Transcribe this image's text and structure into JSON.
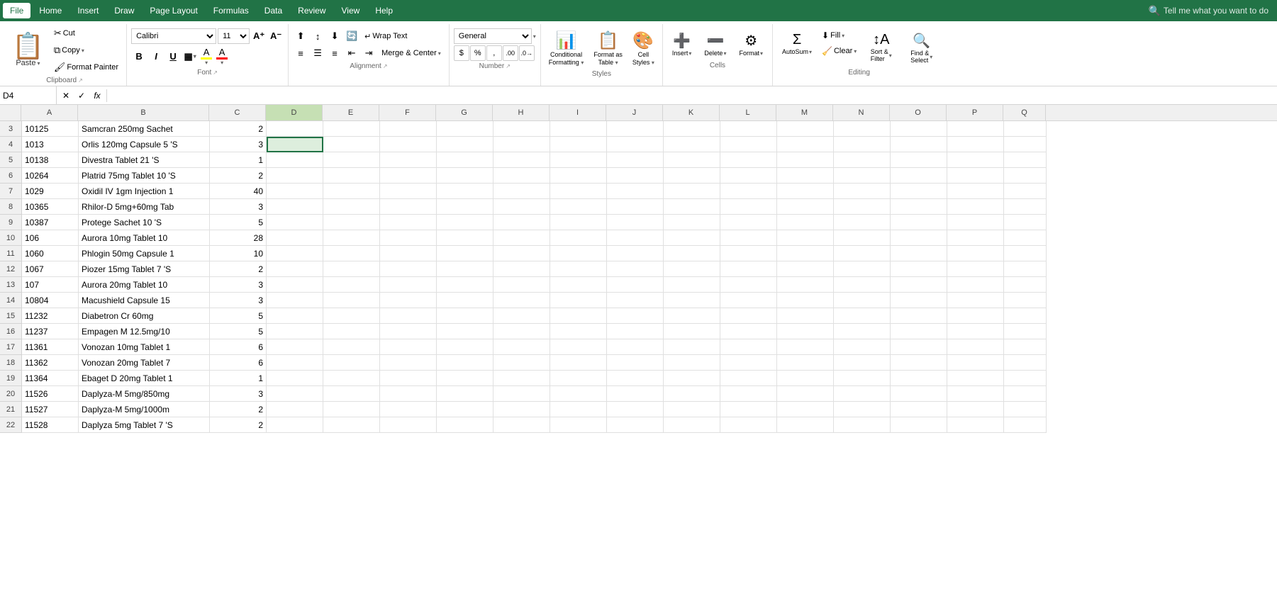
{
  "menu": {
    "items": [
      {
        "label": "File",
        "active": false
      },
      {
        "label": "Home",
        "active": true
      },
      {
        "label": "Insert",
        "active": false
      },
      {
        "label": "Draw",
        "active": false
      },
      {
        "label": "Page Layout",
        "active": false
      },
      {
        "label": "Formulas",
        "active": false
      },
      {
        "label": "Data",
        "active": false
      },
      {
        "label": "Review",
        "active": false
      },
      {
        "label": "View",
        "active": false
      },
      {
        "label": "Help",
        "active": false
      }
    ],
    "search_placeholder": "Tell me what you want to do"
  },
  "ribbon": {
    "clipboard": {
      "label": "Clipboard",
      "paste": "Paste",
      "cut": "Cut",
      "copy": "Copy",
      "format_painter": "Format Painter"
    },
    "font": {
      "label": "Font",
      "family": "Calibri",
      "size": "11",
      "bold": "B",
      "italic": "I",
      "underline": "U",
      "border": "⊞",
      "highlight": "A",
      "color": "A"
    },
    "alignment": {
      "label": "Alignment",
      "wrap_text": "Wrap Text",
      "merge_center": "Merge & Center"
    },
    "number": {
      "label": "Number",
      "format": "General",
      "dollar": "$",
      "percent": "%",
      "comma": ",",
      "increase_decimal": ".0",
      "decrease_decimal": ".00"
    },
    "styles": {
      "label": "Styles",
      "conditional": "Conditional\nFormatting",
      "format_table": "Format as\nTable",
      "cell_styles": "Cell\nStyles"
    },
    "cells": {
      "label": "Cells",
      "insert": "Insert",
      "delete": "Delete",
      "format": "Format"
    },
    "editing": {
      "label": "Editing",
      "autosum": "AutoSum",
      "fill": "Fill",
      "clear": "Clear",
      "sort_filter": "Sort &\nFilter",
      "find_select": "Find &\nSelect"
    }
  },
  "formula_bar": {
    "name_box": "D4",
    "cancel": "✕",
    "confirm": "✓",
    "function": "fx",
    "formula": ""
  },
  "columns": [
    "A",
    "B",
    "C",
    "D",
    "E",
    "F",
    "G",
    "H",
    "I",
    "J",
    "K",
    "L",
    "M",
    "N",
    "O",
    "P",
    "Q"
  ],
  "rows": [
    {
      "num": 3,
      "cells": [
        "10125",
        "Samcran 250mg Sachet",
        "2",
        "",
        "",
        "",
        "",
        "",
        "",
        "",
        "",
        "",
        "",
        "",
        "",
        "",
        ""
      ]
    },
    {
      "num": 4,
      "cells": [
        "1013",
        "Orlis 120mg Capsule 5 'S",
        "3",
        "",
        "",
        "",
        "",
        "",
        "",
        "",
        "",
        "",
        "",
        "",
        "",
        "",
        ""
      ],
      "selected_col": 3
    },
    {
      "num": 5,
      "cells": [
        "10138",
        "Divestra Tablet 21 'S",
        "1",
        "",
        "",
        "",
        "",
        "",
        "",
        "",
        "",
        "",
        "",
        "",
        "",
        "",
        ""
      ]
    },
    {
      "num": 6,
      "cells": [
        "10264",
        "Platrid 75mg Tablet 10 'S",
        "2",
        "",
        "",
        "",
        "",
        "",
        "",
        "",
        "",
        "",
        "",
        "",
        "",
        "",
        ""
      ]
    },
    {
      "num": 7,
      "cells": [
        "1029",
        "Oxidil IV 1gm Injection 1",
        "40",
        "",
        "",
        "",
        "",
        "",
        "",
        "",
        "",
        "",
        "",
        "",
        "",
        "",
        ""
      ]
    },
    {
      "num": 8,
      "cells": [
        "10365",
        "Rhilor-D 5mg+60mg Tab",
        "3",
        "",
        "",
        "",
        "",
        "",
        "",
        "",
        "",
        "",
        "",
        "",
        "",
        "",
        ""
      ]
    },
    {
      "num": 9,
      "cells": [
        "10387",
        "Protege Sachet 10 'S",
        "5",
        "",
        "",
        "",
        "",
        "",
        "",
        "",
        "",
        "",
        "",
        "",
        "",
        "",
        ""
      ]
    },
    {
      "num": 10,
      "cells": [
        "106",
        "Aurora 10mg Tablet 10",
        "28",
        "",
        "",
        "",
        "",
        "",
        "",
        "",
        "",
        "",
        "",
        "",
        "",
        "",
        ""
      ]
    },
    {
      "num": 11,
      "cells": [
        "1060",
        "Phlogin 50mg Capsule 1",
        "10",
        "",
        "",
        "",
        "",
        "",
        "",
        "",
        "",
        "",
        "",
        "",
        "",
        "",
        ""
      ]
    },
    {
      "num": 12,
      "cells": [
        "1067",
        "Piozer 15mg Tablet 7 'S",
        "2",
        "",
        "",
        "",
        "",
        "",
        "",
        "",
        "",
        "",
        "",
        "",
        "",
        "",
        ""
      ]
    },
    {
      "num": 13,
      "cells": [
        "107",
        "Aurora 20mg Tablet 10",
        "3",
        "",
        "",
        "",
        "",
        "",
        "",
        "",
        "",
        "",
        "",
        "",
        "",
        "",
        ""
      ]
    },
    {
      "num": 14,
      "cells": [
        "10804",
        "Macushield Capsule 15",
        "3",
        "",
        "",
        "",
        "",
        "",
        "",
        "",
        "",
        "",
        "",
        "",
        "",
        "",
        ""
      ]
    },
    {
      "num": 15,
      "cells": [
        "11232",
        "Diabetron Cr 60mg",
        "5",
        "",
        "",
        "",
        "",
        "",
        "",
        "",
        "",
        "",
        "",
        "",
        "",
        "",
        ""
      ]
    },
    {
      "num": 16,
      "cells": [
        "11237",
        "Empagen M 12.5mg/10",
        "5",
        "",
        "",
        "",
        "",
        "",
        "",
        "",
        "",
        "",
        "",
        "",
        "",
        "",
        ""
      ]
    },
    {
      "num": 17,
      "cells": [
        "11361",
        "Vonozan 10mg Tablet 1",
        "6",
        "",
        "",
        "",
        "",
        "",
        "",
        "",
        "",
        "",
        "",
        "",
        "",
        "",
        ""
      ]
    },
    {
      "num": 18,
      "cells": [
        "11362",
        "Vonozan 20mg Tablet 7",
        "6",
        "",
        "",
        "",
        "",
        "",
        "",
        "",
        "",
        "",
        "",
        "",
        "",
        "",
        ""
      ]
    },
    {
      "num": 19,
      "cells": [
        "11364",
        "Ebaget D 20mg Tablet 1",
        "1",
        "",
        "",
        "",
        "",
        "",
        "",
        "",
        "",
        "",
        "",
        "",
        "",
        "",
        ""
      ]
    },
    {
      "num": 20,
      "cells": [
        "11526",
        "Daplyza-M 5mg/850mg",
        "3",
        "",
        "",
        "",
        "",
        "",
        "",
        "",
        "",
        "",
        "",
        "",
        "",
        "",
        ""
      ]
    },
    {
      "num": 21,
      "cells": [
        "11527",
        "Daplyza-M 5mg/1000m",
        "2",
        "",
        "",
        "",
        "",
        "",
        "",
        "",
        "",
        "",
        "",
        "",
        "",
        "",
        ""
      ]
    },
    {
      "num": 22,
      "cells": [
        "11528",
        "Daplyza 5mg Tablet 7 'S",
        "2",
        "",
        "",
        "",
        "",
        "",
        "",
        "",
        "",
        "",
        "",
        "",
        "",
        "",
        ""
      ]
    }
  ],
  "colors": {
    "accent_green": "#217346",
    "ribbon_bg": "#ffffff",
    "menu_bg": "#217346",
    "grid_line": "#e0e0e0",
    "header_bg": "#f0f0f0",
    "selected_bg": "#ddeedd",
    "highlight_yellow": "#ffff00",
    "font_red": "#ff0000"
  }
}
